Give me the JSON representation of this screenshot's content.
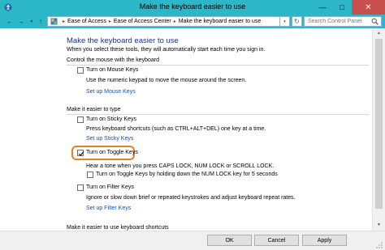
{
  "window": {
    "title": "Make the keyboard easier to use",
    "minimize_glyph": "—",
    "maximize_glyph": "□",
    "close_glyph": "✕"
  },
  "address": {
    "back_glyph": "←",
    "forward_glyph": "→",
    "recent_glyph": "▾",
    "up_glyph": "↑",
    "breadcrumb": [
      "Ease of Access",
      "Ease of Access Center",
      "Make the keyboard easier to use"
    ],
    "separator": "▸",
    "dropdown_glyph": "▾",
    "refresh_glyph": "↻",
    "search_placeholder": "Search Control Panel"
  },
  "main": {
    "heading": "Make the keyboard easier to use",
    "subheading": "When you select these tools, they will automatically start each time you sign in.",
    "sections": [
      {
        "label": "Control the mouse with the keyboard",
        "items": [
          {
            "label": "Turn on Mouse Keys",
            "checked": false,
            "description": "Use the numeric keypad to move the mouse around the screen.",
            "link": "Set up Mouse Keys"
          }
        ]
      },
      {
        "label": "Make it easier to type",
        "items": [
          {
            "label": "Turn on Sticky Keys",
            "checked": false,
            "description": "Press keyboard shortcuts (such as CTRL+ALT+DEL) one key at a time.",
            "link": "Set up Sticky Keys"
          },
          {
            "label": "Turn on Toggle Keys",
            "checked": true,
            "description": "Hear a tone when you press CAPS LOCK, NUM LOCK or SCROLL LOCK.",
            "sub_option": {
              "label": "Turn on Toggle Keys by holding down the NUM LOCK key for 5 seconds",
              "checked": false
            }
          },
          {
            "label": "Turn on Filter Keys",
            "checked": false,
            "description": "Ignore or slow down brief or repeated keystrokes and adjust keyboard repeat rates.",
            "link": "Set up Filter Keys"
          }
        ]
      },
      {
        "label": "Make it easier to use keyboard shortcuts"
      }
    ]
  },
  "scrollbar": {
    "up_glyph": "▲",
    "down_glyph": "▼"
  },
  "footer": {
    "ok": "OK",
    "cancel": "Cancel",
    "apply": "Apply"
  },
  "colors": {
    "titlebar": "#2bb7c8",
    "heading": "#1e3287",
    "link": "#1a4db8",
    "highlight": "#ef7d1f",
    "close": "#c7504c"
  },
  "icons": {
    "window": "ease-of-access-icon",
    "address": "control-panel-icon",
    "search": "search-icon"
  }
}
